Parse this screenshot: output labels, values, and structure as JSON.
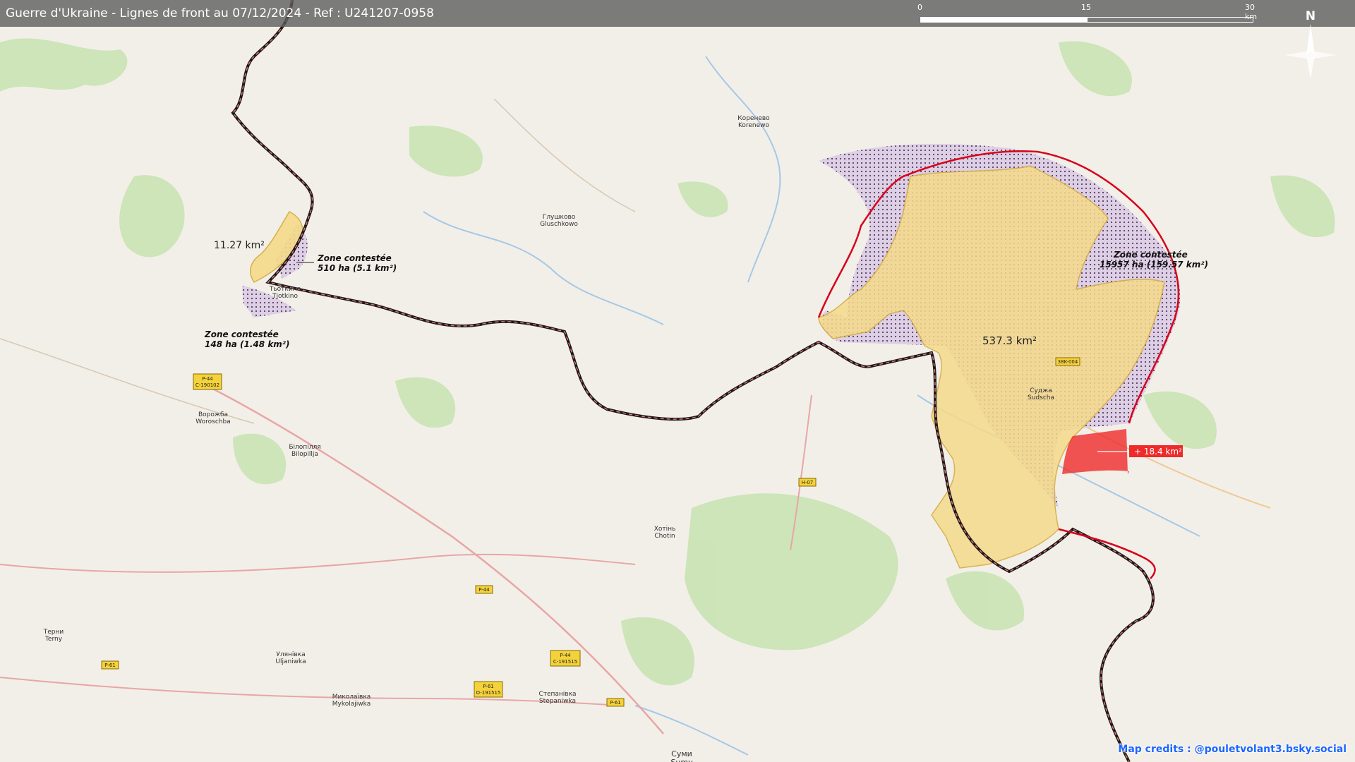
{
  "header": {
    "title": "Guerre d'Ukraine - Lignes de front au 07/12/2024 - Ref : U241207-0958"
  },
  "scale_bar": {
    "ticks": [
      "0",
      "15",
      "30 km"
    ]
  },
  "north_arrow": {
    "label": "N"
  },
  "credits": "Map credits : @pouletvolant3.bsky.social",
  "colors": {
    "occupied": "#f5da8a",
    "contested": "#7a5a8a",
    "frontline": "#d8001a",
    "gain": "#ee2a2a"
  },
  "areas": {
    "north_pocket": {
      "label": "11.27 km²"
    },
    "contested_1": {
      "title": "Zone contestée",
      "detail": "510 ha (5.1 km²)"
    },
    "contested_2": {
      "title": "Zone contestée",
      "detail": "148 ha (1.48 km²)"
    },
    "main": {
      "label": "537.3 km²"
    },
    "contested_3": {
      "title": "Zone contestée",
      "detail": "15957 ha (159.57 km²)"
    },
    "gain": {
      "label": "+ 18.4 km²"
    }
  },
  "places": [
    {
      "name": "Кореневo\nKorenewo",
      "id": "korenewo"
    },
    {
      "name": "Глушково\nGluschkowo",
      "id": "gluschkowo"
    },
    {
      "name": "Суджа\nSudscha",
      "id": "sudscha"
    },
    {
      "name": "Ворожба\nWoroschba",
      "id": "woroschba"
    },
    {
      "name": "Білопілля\nBilopillja",
      "id": "bilopillja"
    },
    {
      "name": "Хотінь\nChotin",
      "id": "chotin"
    },
    {
      "name": "Терни\nTerny",
      "id": "terny"
    },
    {
      "name": "Улянівка\nUljaniwka",
      "id": "uljaniwka"
    },
    {
      "name": "Миколаївка\nMykolajiwka",
      "id": "mykolajiwka"
    },
    {
      "name": "Степанівка\nStepaniwka",
      "id": "stepaniwka"
    },
    {
      "name": "Суми\nSumy",
      "id": "sumy"
    },
    {
      "name": "Тьоткино\nTjotkino",
      "id": "tjotkino"
    }
  ],
  "road_shields": [
    {
      "text": "P-44\nC-190102",
      "id": "p44a"
    },
    {
      "text": "H-07",
      "id": "h07"
    },
    {
      "text": "P-44",
      "id": "p44b"
    },
    {
      "text": "P-44\nC-191515",
      "id": "p44c"
    },
    {
      "text": "P-61",
      "id": "p61a"
    },
    {
      "text": "P-61\nO-191515",
      "id": "p61b"
    },
    {
      "text": "P-61",
      "id": "p61c"
    },
    {
      "text": "38K-004",
      "id": "k004"
    }
  ]
}
